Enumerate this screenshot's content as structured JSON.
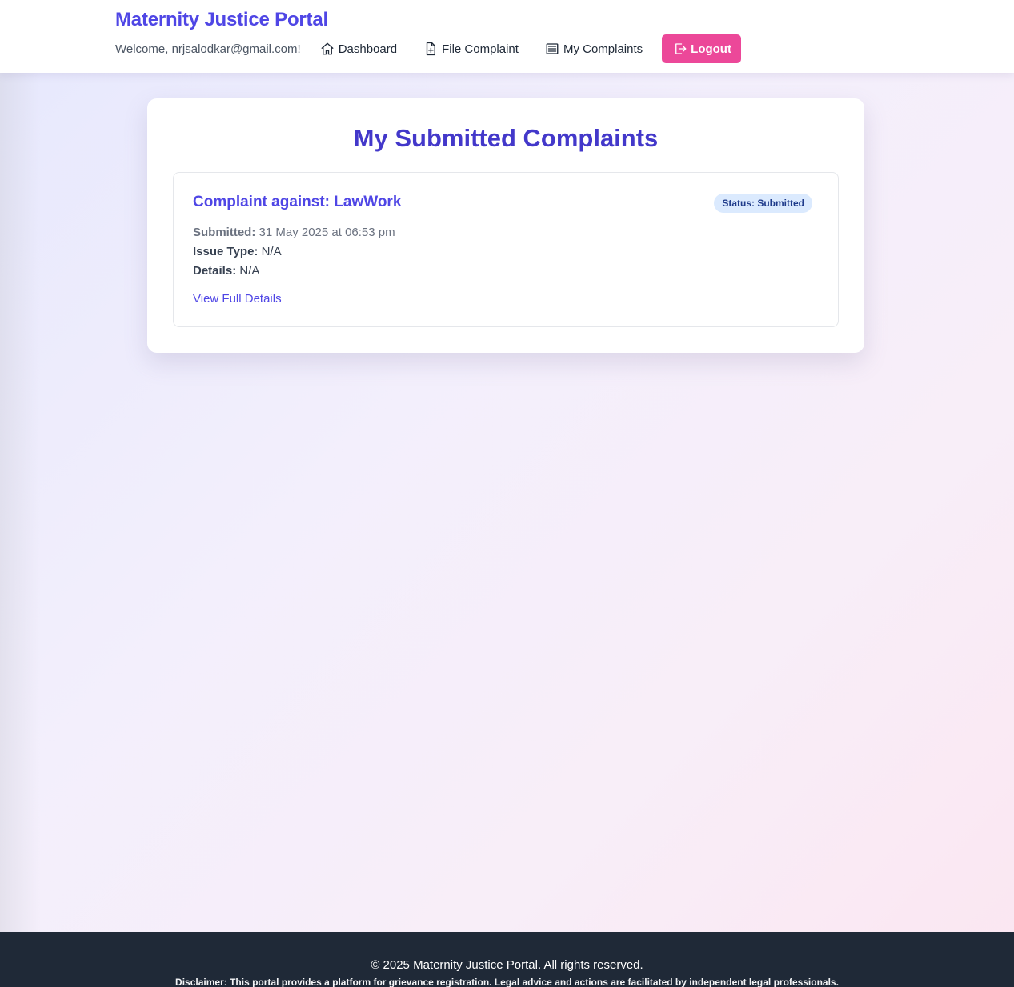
{
  "header": {
    "brand": "Maternity Justice Portal",
    "welcome": "Welcome, nrjsalodkar@gmail.com!",
    "nav": [
      {
        "label": "Dashboard",
        "icon": "home-icon"
      },
      {
        "label": "File Complaint",
        "icon": "file-plus-icon"
      },
      {
        "label": "My Complaints",
        "icon": "list-icon"
      }
    ],
    "logout": {
      "label": "Logout",
      "icon": "logout-icon"
    },
    "colors": {
      "brand": "#4f46e5",
      "logout_bg": "#ec4899"
    }
  },
  "main": {
    "title": "My Submitted Complaints",
    "complaints": [
      {
        "title": "Complaint against: LawWork",
        "status": "Status: Submitted",
        "submitted_label": "Submitted:",
        "submitted_value": "31 May 2025 at 06:53 pm",
        "issue_label": "Issue Type:",
        "issue_value": "N/A",
        "details_label": "Details:",
        "details_value": "N/A",
        "link": "View Full Details"
      }
    ]
  },
  "footer": {
    "copyright": "© 2025 Maternity Justice Portal. All rights reserved.",
    "disclaimer": "Disclaimer: This portal provides a platform for grievance registration. Legal advice and actions are facilitated by independent legal professionals.",
    "background": "#1f2937"
  }
}
